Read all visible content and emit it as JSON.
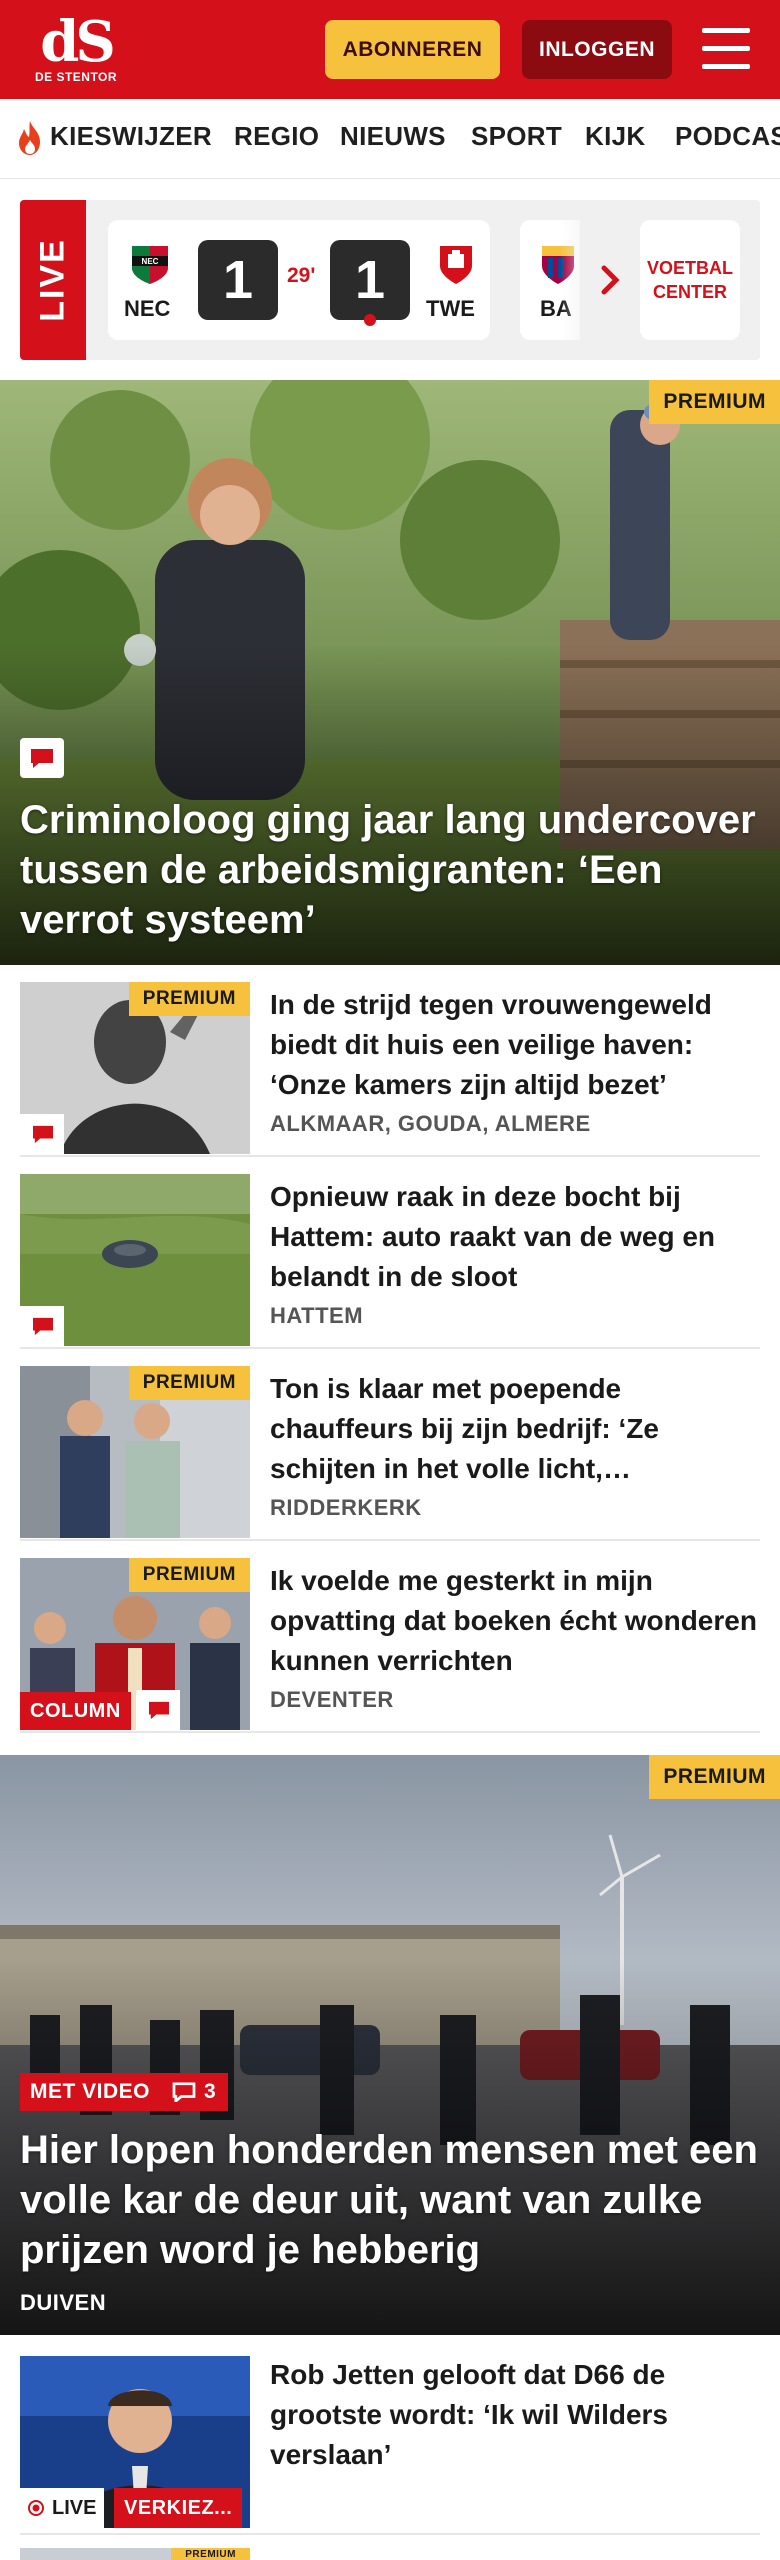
{
  "header": {
    "logo_mark": "dS",
    "logo_text": "DE STENTOR",
    "subscribe_label": "ABONNEREN",
    "login_label": "INLOGGEN"
  },
  "nav": {
    "items": [
      "KIESWIJZER",
      "REGIO",
      "NIEUWS",
      "SPORT",
      "KIJK",
      "PODCAS"
    ]
  },
  "live": {
    "label": "LIVE",
    "match": {
      "home": "NEC",
      "away": "TWE",
      "home_score": "1",
      "away_score": "1",
      "minute": "29'"
    },
    "next_match_team": "BA",
    "voetbal_center_label": "VOETBAL CENTER"
  },
  "hero": {
    "badge": "PREMIUM",
    "title": "Criminoloog ging jaar lang undercover tussen de arbeidsmigranten: ‘Een verrot systeem’"
  },
  "articles": [
    {
      "badge": "PREMIUM",
      "title": "In de strijd tegen vrouwengeweld biedt dit huis een veilige haven: ‘Onze kamers zijn altijd bezet’",
      "location": "ALKMAAR, GOUDA, ALMERE"
    },
    {
      "badge": "",
      "title": "Opnieuw raak in deze bocht bij Hattem: auto raakt van de weg en belandt in de sloot",
      "location": "HATTEM"
    },
    {
      "badge": "PREMIUM",
      "title": "Ton is klaar met poepende chauffeurs bij zijn bedrijf: ‘Ze schijten in het volle licht,…",
      "location": "RIDDERKERK"
    },
    {
      "badge": "PREMIUM",
      "label": "COLUMN",
      "title": "Ik voelde me gesterkt in mijn opvatting dat boeken écht wonderen kunnen verrichten",
      "location": "DEVENTER"
    }
  ],
  "hero2": {
    "badge": "PREMIUM",
    "video_label": "MET VIDEO",
    "comment_count": "3",
    "title": "Hier lopen honderden mensen met een volle kar de deur uit, want van zulke prijzen word je hebberig",
    "location": "DUIVEN"
  },
  "article_bottom": {
    "title": "Rob Jetten gelooft dat D66 de grootste wordt: ‘Ik wil Wilders verslaan’",
    "live_label": "LIVE",
    "tag_label": "VERKIEZ..."
  },
  "partial_next": {
    "badge": "PREMIUM"
  },
  "colors": {
    "brand_red": "#d4101a",
    "premium_yellow": "#f6c23e",
    "login_dark_red": "#8c0b11"
  }
}
